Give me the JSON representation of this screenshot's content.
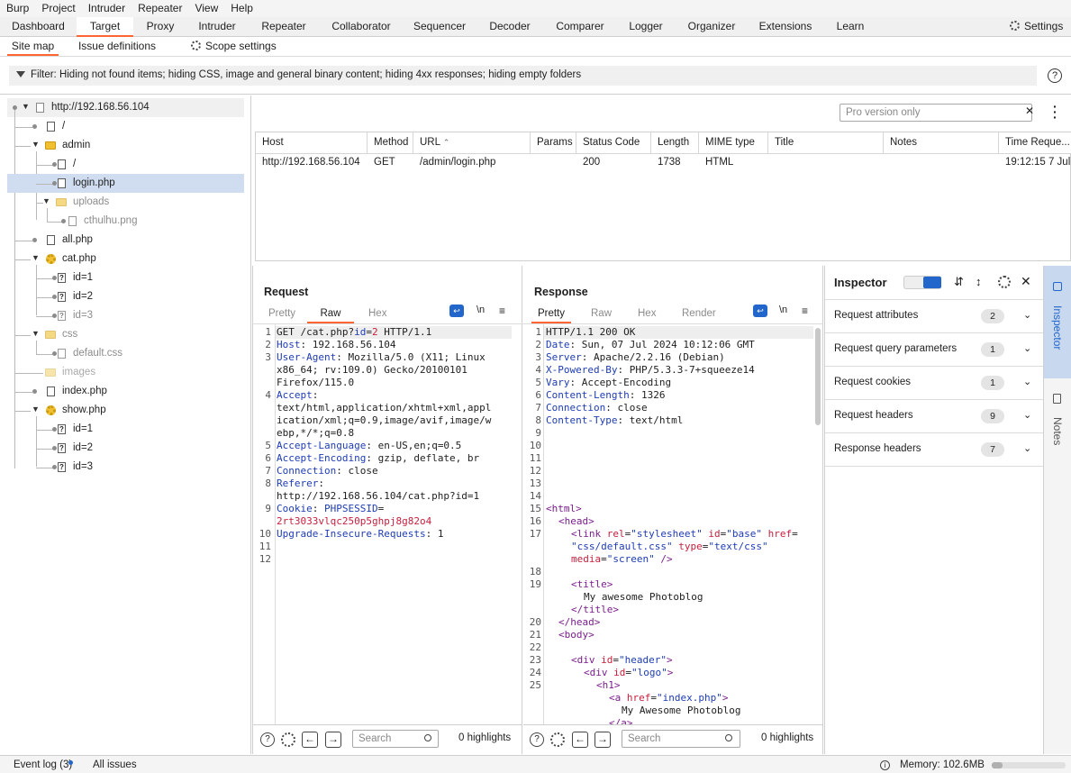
{
  "menu": [
    "Burp",
    "Project",
    "Intruder",
    "Repeater",
    "View",
    "Help"
  ],
  "tabs": {
    "dashboard": "Dashboard",
    "target": "Target",
    "proxy": "Proxy",
    "intruder": "Intruder",
    "repeater": "Repeater",
    "collaborator": "Collaborator",
    "sequencer": "Sequencer",
    "decoder": "Decoder",
    "comparer": "Comparer",
    "logger": "Logger",
    "organizer": "Organizer",
    "extensions": "Extensions",
    "learn": "Learn",
    "settings": "Settings"
  },
  "subtabs": {
    "site_map": "Site map",
    "issue_definitions": "Issue definitions",
    "scope_settings": "Scope settings"
  },
  "filter": "Filter: Hiding not found items;  hiding CSS, image and general binary content;  hiding 4xx responses;  hiding empty folders",
  "tree": {
    "host": "http://192.168.56.104",
    "root_slash": "/",
    "admin": "admin",
    "admin_slash": "/",
    "login": "login.php",
    "uploads": "uploads",
    "cthulhu": "cthulhu.png",
    "all": "all.php",
    "cat": "cat.php",
    "cat_id1": "id=1",
    "cat_id2": "id=2",
    "cat_id3": "id=3",
    "css": "css",
    "default_css": "default.css",
    "images": "images",
    "index": "index.php",
    "show": "show.php",
    "show_id1": "id=1",
    "show_id2": "id=2",
    "show_id3": "id=3"
  },
  "table": {
    "search_placeholder": "Pro version only",
    "headers": {
      "host": "Host",
      "method": "Method",
      "url": "URL",
      "params": "Params",
      "status": "Status Code",
      "length": "Length",
      "mime": "MIME type",
      "title": "Title",
      "notes": "Notes",
      "time": "Time Reque..."
    },
    "row": {
      "host": "http://192.168.56.104",
      "method": "GET",
      "url": "/admin/login.php",
      "params": "",
      "status": "200",
      "length": "1738",
      "mime": "HTML",
      "title": "",
      "notes": "",
      "time": "19:12:15 7 Jul..."
    }
  },
  "request": {
    "title": "Request",
    "tabs": {
      "pretty": "Pretty",
      "raw": "Raw",
      "hex": "Hex"
    },
    "newline_toggle": "\\n",
    "search_placeholder": "Search",
    "highlights": "0 highlights",
    "l1a": "GET /cat.php?",
    "l1b": "id",
    "l1c": "=",
    "l1d": "2",
    " l1e": "",
    "l1f": " HTTP/1.1",
    "l2k": "Host",
    "l2v": ": 192.168.56.104",
    "l3k": "User-Agent",
    "l3v": ": Mozilla/5.0 (X11; Linux",
    "l3b": "x86_64; rv:109.0) Gecko/20100101",
    "l3c": "Firefox/115.0",
    "l4k": "Accept",
    "l4v": ":",
    "l4b": "text/html,application/xhtml+xml,appl",
    "l4c": "ication/xml;q=0.9,image/avif,image/w",
    "l4d": "ebp,*/*;q=0.8",
    "l5k": "Accept-Language",
    "l5v": ": en-US,en;q=0.5",
    "l6k": "Accept-Encoding",
    "l6v": ": gzip, deflate, br",
    "l7k": "Connection",
    "l7v": ": close",
    "l8k": "Referer",
    "l8v": ":",
    "l8b": "http://192.168.56.104/cat.php?id=1",
    "l9k": "Cookie",
    "l9v": ": ",
    "l9c": "PHPSESSID",
    "l9e": "=",
    "l9b": "2rt3033vlqc250p5ghpj8g82o4",
    "l10k": "Upgrade-Insecure-Requests",
    "l10v": ": 1",
    "linenos": [
      "1",
      "2",
      "3",
      "",
      "",
      "4",
      "",
      "",
      "",
      "5",
      "6",
      "7",
      "8",
      "",
      "9",
      "",
      "10",
      "11",
      "12"
    ]
  },
  "response": {
    "title": "Response",
    "tabs": {
      "pretty": "Pretty",
      "raw": "Raw",
      "hex": "Hex",
      "render": "Render"
    },
    "newline_toggle": "\\n",
    "search_placeholder": "Search",
    "highlights": "0 highlights",
    "l1": "HTTP/1.1 200 OK",
    "l2k": "Date",
    "l2v": ": Sun, 07 Jul 2024 10:12:06 GMT",
    "l3k": "Server",
    "l3v": ": Apache/2.2.16 (Debian)",
    "l4k": "X-Powered-By",
    "l4v": ": PHP/5.3.3-7+squeeze14",
    "l5k": "Vary",
    "l5v": ": Accept-Encoding",
    "l6k": "Content-Length",
    "l6v": ": 1326",
    "l7k": "Connection",
    "l7v": ": close",
    "l8k": "Content-Type",
    "l8v": ": text/html",
    "linenos": [
      "1",
      "2",
      "3",
      "4",
      "5",
      "6",
      "7",
      "8",
      "9",
      "10",
      "11",
      "12",
      "13",
      "14",
      "15",
      "16",
      "17",
      "",
      "",
      "18",
      "19",
      "",
      "",
      "20",
      "21",
      "22",
      "23",
      "24",
      "25",
      "",
      ""
    ],
    "html_open": "<html>",
    "head_open": "<head>",
    "link_a": "<link ",
    "link_rel": "rel",
    "link_eq1": "=",
    "link_relv": "\"stylesheet\"",
    "link_id": " id",
    "link_eq2": "=",
    "link_idv": "\"base\"",
    "link_href": " href",
    "link_eq3": "=",
    "link_hrefv": "\"css/default.css\"",
    "link_type": " type",
    "link_eq4": "=",
    "link_typev": "\"text/css\"",
    "link_media": "media",
    "link_eq5": "=",
    "link_mediav": "\"screen\"",
    "link_close": " />",
    "title_open": "<title>",
    "title_text": "My awesome Photoblog",
    "title_close": "</title>",
    "head_close": "</head>",
    "body_open": "<body>",
    "div1a": "<div ",
    "div1id": "id",
    "div1eq": "=",
    "div1v": "\"header\"",
    "div1c": ">",
    "div2a": "<div ",
    "div2id": "id",
    "div2eq": "=",
    "div2v": "\"logo\"",
    "div2c": ">",
    "h1": "<h1>",
    "a1": "<a ",
    "ahref": "href",
    "aeq": "=",
    "ahrefv": "\"index.php\"",
    "ac": ">",
    "atext": "My Awesome Photoblog",
    "aclose": "</a>"
  },
  "inspector": {
    "title": "Inspector",
    "rows": [
      {
        "label": "Request attributes",
        "count": "2"
      },
      {
        "label": "Request query parameters",
        "count": "1"
      },
      {
        "label": "Request cookies",
        "count": "1"
      },
      {
        "label": "Request headers",
        "count": "9"
      },
      {
        "label": "Response headers",
        "count": "7"
      }
    ]
  },
  "sidepanel": {
    "inspector": "Inspector",
    "notes": "Notes"
  },
  "status": {
    "event_log": "Event log (3)",
    "all_issues": "All issues",
    "memory": "Memory: 102.6MB",
    "memory_fraction": 0.15
  },
  "colors": {
    "accent": "#ff6633",
    "selection": "#d0ddf0",
    "active_blue": "#2266cc"
  }
}
